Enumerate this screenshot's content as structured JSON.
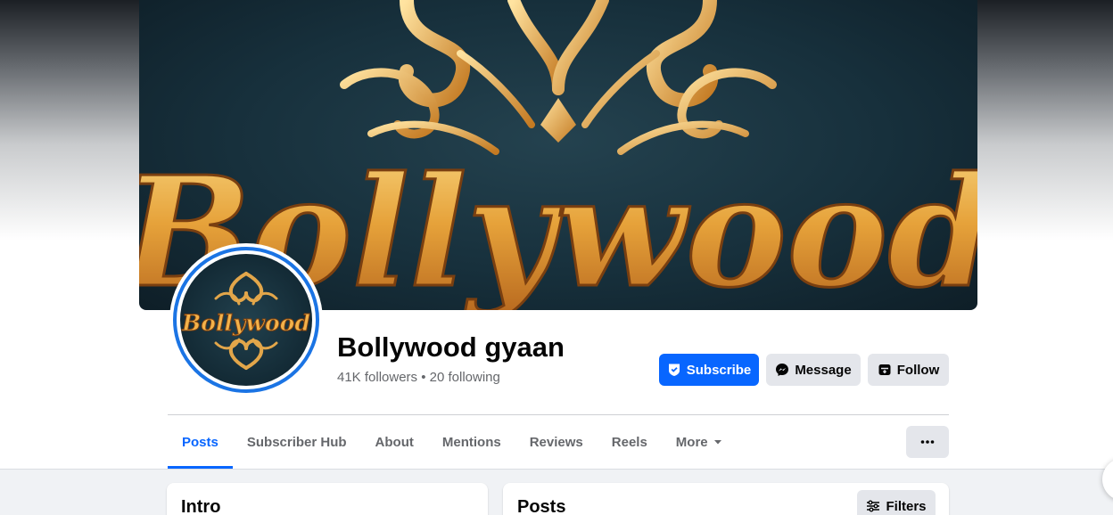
{
  "cover": {
    "title": "Bollywood"
  },
  "avatar": {
    "title": "Bollywood"
  },
  "profile": {
    "name": "Bollywood gyaan",
    "stats": "41K followers • 20 following"
  },
  "actions": {
    "subscribe": "Subscribe",
    "message": "Message",
    "follow": "Follow"
  },
  "tabs": [
    {
      "label": "Posts",
      "active": true
    },
    {
      "label": "Subscriber Hub"
    },
    {
      "label": "About"
    },
    {
      "label": "Mentions"
    },
    {
      "label": "Reviews"
    },
    {
      "label": "Reels"
    },
    {
      "label": "More"
    }
  ],
  "feed": {
    "intro_title": "Intro",
    "posts_title": "Posts",
    "filters_label": "Filters"
  },
  "colors": {
    "accent": "#0866ff",
    "avatar_ring": "#1b74e4",
    "secondary_button": "#e4e6eb"
  },
  "icons": {
    "subscribe": "subscribe-badge-icon",
    "message": "messenger-icon",
    "follow": "follow-icon",
    "more": "caret-down-icon",
    "options": "ellipsis-icon",
    "filters": "filters-sliders-icon"
  }
}
